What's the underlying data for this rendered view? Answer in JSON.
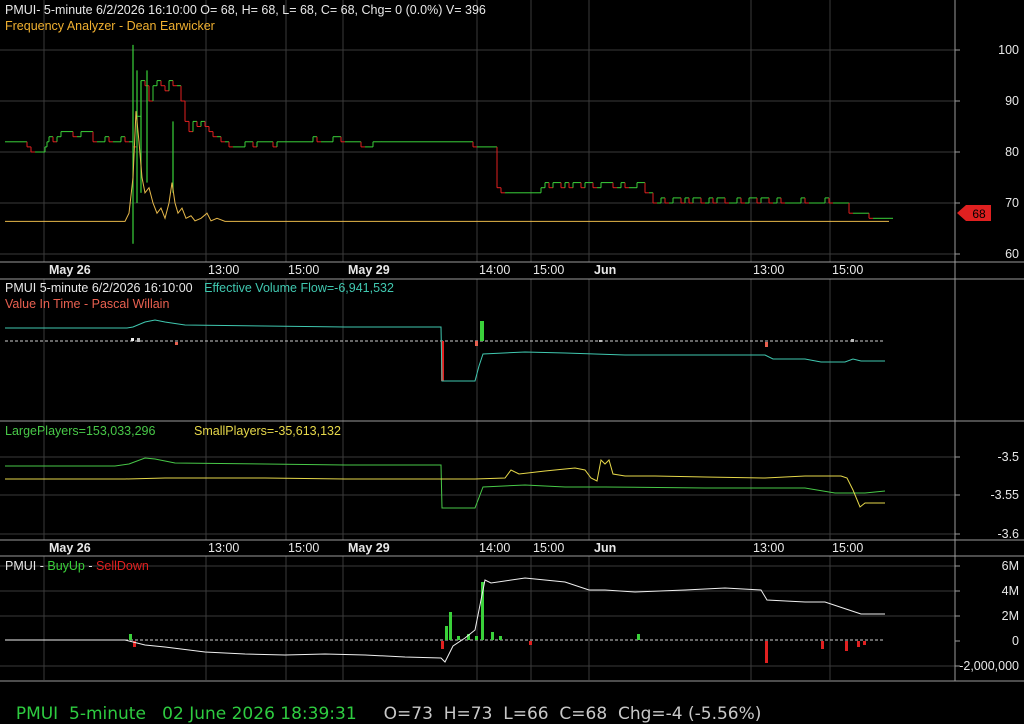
{
  "colors": {
    "background": "#000000",
    "grid": "#3a3a3a",
    "separator": "#9a9a9a",
    "text": "#e8e8e8",
    "up": "#3ad13a",
    "down": "#e02020",
    "yellow": "#e6d84a",
    "orange": "#f0b030",
    "teal": "#40c8b0",
    "green_line": "#48c848",
    "white_line": "#f0f0f0",
    "salmon": "#e86050",
    "status_green": "#2ecc40"
  },
  "panel1": {
    "header": "PMUI- 5-minute 6/2/2026 16:10:00 O= 68, H= 68, L= 68, C= 68, Chg= 0 (0.0%) V= 396",
    "subtitle": "Frequency Analyzer - Dean Earwicker",
    "y_ticks": [
      "100",
      "90",
      "80",
      "70",
      "60"
    ],
    "last_price": "68"
  },
  "x_axis": {
    "labels": [
      "May 26",
      "13:00",
      "15:00",
      "May 29",
      "14:00",
      "15:00",
      "Jun",
      "13:00",
      "15:00"
    ],
    "bold": [
      "May 26",
      "May 29",
      "Jun"
    ]
  },
  "panel2": {
    "header_left": "PMUI 5-minute  6/2/2026 16:10:00",
    "header_right": "Effective Volume Flow=-6,941,532",
    "subtitle": "Value In Time - Pascal Willain"
  },
  "panel3": {
    "large": "LargePlayers=153,033,296",
    "small": "SmallPlayers=-35,613,132",
    "y_ticks": [
      "-3.5",
      "-3.55",
      "-3.6"
    ]
  },
  "panel4": {
    "title_prefix": "PMUI - ",
    "title_buy": "BuyUp",
    "title_dash": "-",
    "title_sell": "SellDown",
    "y_ticks": [
      "6M",
      "4M",
      "2M",
      "0",
      "-2,000,000"
    ]
  },
  "status": {
    "symbol": "PMUI",
    "interval": "5-minute",
    "datetime": "02 June 2026 18:39:31",
    "open": "O=73",
    "high": "H=73",
    "low": "L=66",
    "close": "C=68",
    "change": "Chg=-4 (-5.56%)"
  },
  "chart_data": {
    "type": "line",
    "title": "PMUI 5-minute",
    "x_span": [
      "May 26",
      "Jun 2 16:10"
    ],
    "series": [
      {
        "name": "PMUI",
        "kind": "ohlc",
        "ylim": [
          55,
          105
        ],
        "x": [
          0,
          4,
          8,
          12,
          16,
          22,
          26,
          30,
          34,
          36,
          38,
          40,
          42,
          44,
          46,
          48,
          52,
          56,
          60,
          64,
          68,
          72,
          76,
          80,
          84,
          88,
          92,
          94,
          96,
          98,
          100,
          104,
          108,
          112,
          116,
          120,
          124,
          128,
          132,
          136,
          140,
          144,
          148,
          152,
          156,
          160,
          164,
          168,
          172,
          176,
          180,
          184,
          188,
          192,
          196,
          200,
          204,
          208,
          212,
          216,
          220,
          224,
          228,
          232,
          236,
          240,
          244,
          248,
          252,
          256,
          260,
          264,
          268,
          272,
          276,
          280,
          284,
          288,
          292,
          296,
          300,
          304,
          308,
          312,
          316,
          320,
          324,
          328,
          332,
          336,
          340,
          344,
          348,
          352,
          356,
          360,
          364,
          368,
          372,
          376,
          380,
          384,
          388,
          392,
          396,
          400,
          404,
          408,
          412,
          416,
          420,
          424,
          428,
          432,
          436,
          440,
          444,
          448,
          452,
          456,
          460,
          464,
          468,
          472,
          476,
          480,
          484,
          488,
          492,
          496,
          500,
          504,
          508,
          512,
          516,
          520,
          524,
          528,
          532,
          536,
          540,
          544,
          548,
          552,
          556,
          560,
          564,
          568,
          572,
          576,
          580,
          584,
          588,
          592,
          596,
          600,
          604,
          608,
          612,
          616,
          620,
          624,
          628,
          632,
          636,
          640,
          644,
          648,
          652,
          656,
          660,
          664,
          668,
          672,
          676,
          680,
          684,
          688,
          692,
          696,
          700,
          704,
          708,
          712,
          716,
          720,
          724,
          728,
          732,
          736,
          740,
          744,
          748,
          752,
          756,
          760,
          764,
          768,
          772,
          776,
          780,
          784,
          788,
          792,
          796,
          800,
          804,
          808,
          812,
          816,
          820,
          824,
          828,
          832,
          836,
          840,
          844,
          848,
          852,
          856,
          860,
          864,
          868,
          872,
          876,
          880,
          884
        ],
        "close": [
          82,
          82,
          82,
          82,
          82,
          81,
          80,
          80,
          80,
          80,
          80,
          81,
          82,
          83,
          83,
          82,
          83,
          84,
          84,
          84,
          83,
          83,
          84,
          84,
          84,
          82,
          82,
          82,
          82,
          82,
          83,
          82,
          82,
          82,
          83,
          82,
          82,
          81,
          87,
          94,
          93,
          90,
          93,
          94,
          93,
          92,
          94,
          93,
          93,
          90,
          86,
          84,
          86,
          85,
          86,
          85,
          84,
          83,
          83,
          82,
          82,
          81,
          81,
          81,
          81,
          82,
          82,
          81,
          82,
          82,
          82,
          82,
          81,
          82,
          82,
          82,
          82,
          82,
          82,
          82,
          82,
          82,
          83,
          82,
          82,
          82,
          82,
          83,
          83,
          82,
          82,
          82,
          82,
          82,
          81,
          81,
          81,
          82,
          82,
          82,
          82,
          82,
          82,
          82,
          82,
          82,
          82,
          82,
          82,
          82,
          82,
          82,
          82,
          82,
          82,
          82,
          82,
          82,
          82,
          82,
          82,
          82,
          81,
          81,
          81,
          81,
          81,
          81,
          73,
          72,
          72,
          72,
          72,
          72,
          72,
          72,
          72,
          72,
          72,
          73,
          74,
          73,
          74,
          74,
          73,
          74,
          73,
          74,
          74,
          73,
          74,
          74,
          73,
          73,
          74,
          74,
          74,
          73,
          73,
          74,
          73,
          73,
          73,
          74,
          74,
          72,
          72,
          70,
          70,
          71,
          70,
          70,
          71,
          71,
          70,
          71,
          70,
          71,
          71,
          70,
          70,
          71,
          70,
          71,
          71,
          70,
          70,
          70,
          71,
          70,
          70,
          71,
          71,
          70,
          71,
          71,
          70,
          70,
          71,
          70,
          70,
          70,
          70,
          70,
          71,
          70,
          70,
          70,
          70,
          70,
          71,
          70,
          70,
          70,
          70,
          70,
          68,
          68,
          68,
          68,
          68,
          67,
          67,
          67,
          67,
          67,
          67,
          67,
          68,
          68,
          68,
          68,
          68
        ]
      },
      {
        "name": "Frequency Analyzer - Dean Earwicker",
        "kind": "line",
        "ylim": [
          55,
          105
        ],
        "note": "baseline 66-67 with spike to ~88 near May 26 10:30"
      },
      {
        "name": "Effective Volume Flow",
        "kind": "line",
        "value": -6941532
      },
      {
        "name": "LargePlayers",
        "kind": "line",
        "ylim": [
          -3.6,
          -3.45
        ],
        "value": 153033296
      },
      {
        "name": "SmallPlayers",
        "kind": "line",
        "value": -35613132
      },
      {
        "name": "BuyUp-SellDown",
        "kind": "line",
        "ylim": [
          -2500000,
          7000000
        ],
        "note": "cumulative rises from about -0.8M to ~4.8M near May 29 13:30, ends ~2.2M"
      }
    ]
  }
}
